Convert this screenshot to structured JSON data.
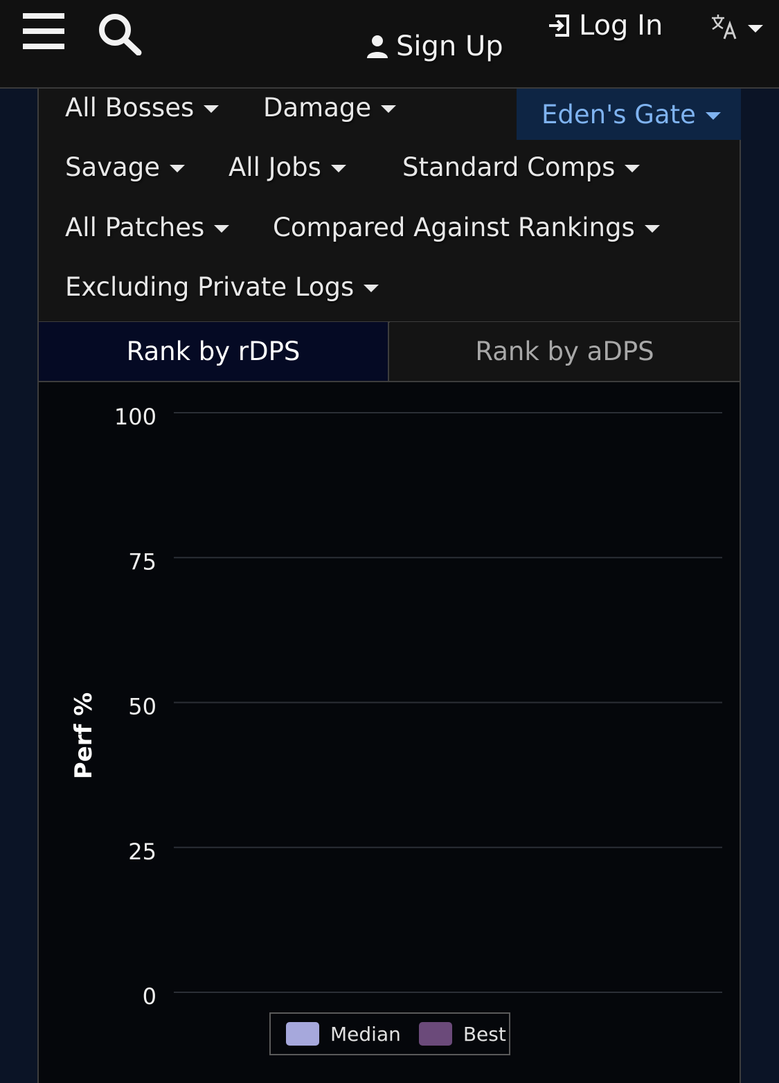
{
  "header": {
    "sign_up": "Sign Up",
    "log_in": "Log In",
    "language_icon": "translate-icon"
  },
  "filters": {
    "row1": [
      "All Bosses",
      "Damage"
    ],
    "active": "Eden's Gate",
    "row2": [
      "Savage",
      "All Jobs",
      "Standard Comps"
    ],
    "row3": [
      "All Patches",
      "Compared Against Rankings"
    ],
    "row4": [
      "Excluding Private Logs"
    ]
  },
  "tabs": {
    "rdps": "Rank by rDPS",
    "adps": "Rank by aDPS"
  },
  "colors": {
    "active_filter_bg": "#0e2544",
    "active_filter_text": "#7fb3f0",
    "median": "#a6a8dc",
    "best": "#6b4a7a"
  },
  "chart_data": {
    "type": "bar",
    "title": "",
    "xlabel": "",
    "ylabel": "Perf %",
    "ylim": [
      0,
      100
    ],
    "yticks": [
      "100",
      "75",
      "50",
      "25",
      "0"
    ],
    "categories": [],
    "series": [
      {
        "name": "Median",
        "values": []
      },
      {
        "name": "Best",
        "values": []
      }
    ],
    "grid": true,
    "legend": "bottom-center"
  }
}
